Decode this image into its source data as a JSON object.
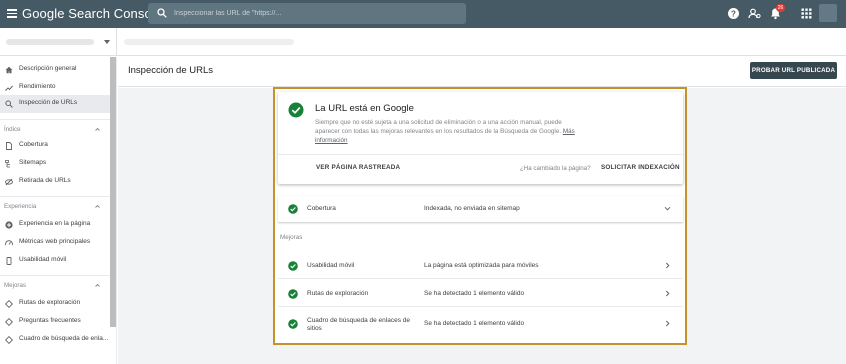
{
  "app": {
    "title": "Google Search Console",
    "search_placeholder": "Inspeccionar las URL de \"https://...",
    "notification_count": "26"
  },
  "sidebar": {
    "items": [
      {
        "label": "Descripción general",
        "icon": "home-icon"
      },
      {
        "label": "Rendimiento",
        "icon": "trending-icon"
      },
      {
        "label": "Inspección de URLs",
        "icon": "search-icon",
        "active": true
      }
    ],
    "sections": [
      {
        "title": "Índice",
        "items": [
          {
            "label": "Cobertura",
            "icon": "file-icon"
          },
          {
            "label": "Sitemaps",
            "icon": "sitemap-icon"
          },
          {
            "label": "Retirada de URLs",
            "icon": "eye-off-icon"
          }
        ]
      },
      {
        "title": "Experiencia",
        "items": [
          {
            "label": "Experiencia en la página",
            "icon": "plus-circle-icon"
          },
          {
            "label": "Métricas web principales",
            "icon": "speed-icon"
          },
          {
            "label": "Usabilidad móvil",
            "icon": "phone-icon"
          }
        ]
      },
      {
        "title": "Mejoras",
        "items": [
          {
            "label": "Rutas de exploración",
            "icon": "diamond-icon"
          },
          {
            "label": "Preguntas frecuentes",
            "icon": "diamond-icon"
          },
          {
            "label": "Cuadro de búsqueda de enla...",
            "icon": "diamond-icon"
          }
        ]
      }
    ]
  },
  "main": {
    "page_title": "Inspección de URLs",
    "test_button": "PROBAR URL PUBLICADA",
    "status": {
      "title": "La URL está en Google",
      "description": "Siempre que no esté sujeta a una solicitud de eliminación o a una acción manual, puede aparecer con todas las mejoras relevantes en los resultados de la Búsqueda de Google.",
      "more_link": "Más información",
      "view_crawled": "VER PÁGINA RASTREADA",
      "changed_question": "¿Ha cambiado la página?",
      "request_indexing": "SOLICITAR INDEXACIÓN"
    },
    "coverage": {
      "label": "Cobertura",
      "value": "Indexada, no enviada en sitemap"
    },
    "improvements_title": "Mejoras",
    "improvements": [
      {
        "label": "Usabilidad móvil",
        "value": "La página está optimizada para móviles"
      },
      {
        "label": "Rutas de exploración",
        "value": "Se ha detectado 1 elemento válido"
      },
      {
        "label": "Cuadro de búsqueda de enlaces de sitios",
        "value": "Se ha detectado 1 elemento válido"
      }
    ]
  },
  "colors": {
    "topbar": "#455a64",
    "success_green": "#188038",
    "highlight_frame": "#c4932a",
    "primary_button": "#37474f"
  }
}
